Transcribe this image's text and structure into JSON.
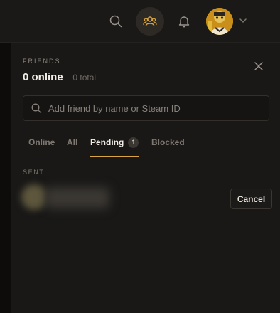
{
  "topbar": {
    "search_icon": "search-icon",
    "friends_icon": "friends-icon",
    "bell_icon": "bell-icon",
    "avatar": "user-avatar",
    "chevron_icon": "chevron-down-icon"
  },
  "panel": {
    "eyebrow": "FRIENDS",
    "online_label": "0 online",
    "dot": "·",
    "total_label": "0 total",
    "search_placeholder": "Add friend by name or Steam ID",
    "tabs": [
      {
        "label": "Online"
      },
      {
        "label": "All"
      },
      {
        "label": "Pending",
        "badge": "1"
      },
      {
        "label": "Blocked"
      }
    ],
    "section_label": "SENT",
    "requests": [
      {
        "action_label": "Cancel"
      }
    ]
  },
  "colors": {
    "accent": "#d9a441",
    "background": "#191817",
    "topbar": "#1a1918"
  }
}
